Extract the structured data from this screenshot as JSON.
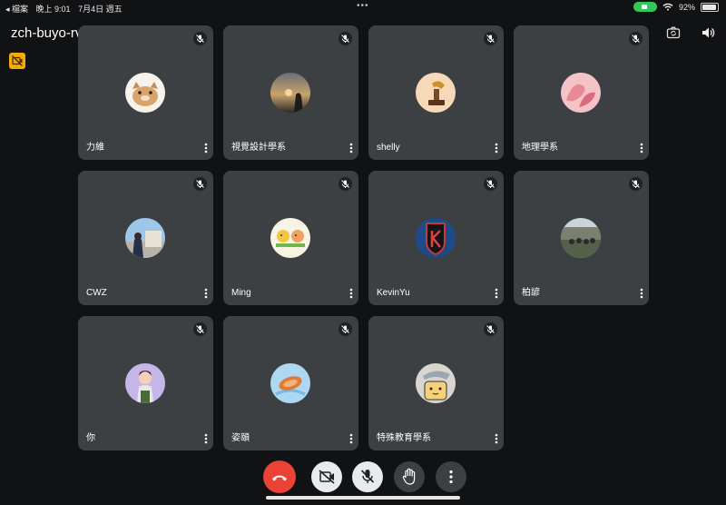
{
  "status_bar": {
    "back_app": "◂ 檔案",
    "time": "晚上 9:01",
    "date": "7月4日 週五",
    "battery": "92%",
    "battery_level": 0.92
  },
  "meeting": {
    "code": "zch-buyo-rvz"
  },
  "icons": {
    "switch_camera": "switch-camera-icon",
    "speaker": "speaker-icon",
    "notice": "camera-off-notice-icon",
    "mic_off": "mic-off-icon",
    "more": "more-vert-icon",
    "end_call": "end-call-icon",
    "camera_off": "camera-off-icon",
    "raise_hand": "raise-hand-icon"
  },
  "colors": {
    "tile_bg": "#3c4043",
    "end_call": "#ea4335",
    "notice": "#f9ab00",
    "camera_indicator": "#34c759"
  },
  "participants": [
    {
      "name": "力維"
    },
    {
      "name": "視覺設計學系"
    },
    {
      "name": "shelly"
    },
    {
      "name": "地理學系"
    },
    {
      "name": "CWZ"
    },
    {
      "name": "Ming"
    },
    {
      "name": "KevinYu"
    },
    {
      "name": "柏諺"
    },
    {
      "name": "你"
    },
    {
      "name": "姿頤"
    },
    {
      "name": "特殊教育學系"
    }
  ]
}
